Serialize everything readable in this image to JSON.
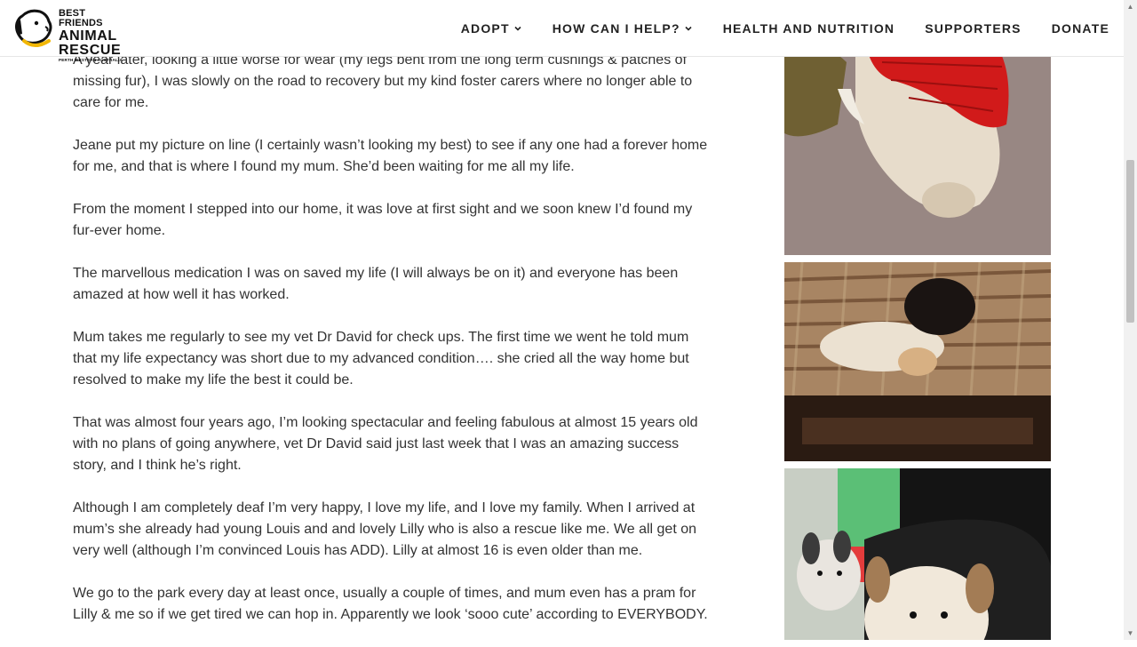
{
  "brand": {
    "line1": "BEST FRIENDS",
    "line2": "ANIMAL",
    "line3": "RESCUE",
    "line4": "PERTH WESTERN AUSTRALIA",
    "accent": "#f2b705"
  },
  "nav": {
    "items": [
      {
        "label": "ADOPT",
        "has_dropdown": true
      },
      {
        "label": "HOW CAN I HELP?",
        "has_dropdown": true
      },
      {
        "label": "HEALTH AND NUTRITION",
        "has_dropdown": false
      },
      {
        "label": "SUPPORTERS",
        "has_dropdown": false
      },
      {
        "label": "DONATE",
        "has_dropdown": false
      }
    ]
  },
  "story": {
    "paragraphs": [
      "A year later, looking a little worse for wear (my legs bent from the long term cushings & patches of missing fur), I was slowly on the road to recovery but my kind foster carers where no longer able to care for me.",
      "Jeane put my picture on line (I certainly wasn’t looking my best) to see if any one had a forever home for me, and that is where I found my mum. She’d been waiting for me all my life.",
      "From the moment I stepped into our home, it was love at first sight and we soon knew I’d found my fur-ever home.",
      "The marvellous medication I was on saved my life (I will always be on it) and everyone has been amazed at how well it has worked.",
      "Mum takes me regularly to see my vet Dr David for check ups. The first time we went he told mum that my life expectancy was short due to my advanced condition…. she cried all the way home but resolved to make my life the best it could be.",
      "That was almost four years ago, I’m looking spectacular and feeling fabulous at almost 15 years old with no plans of going anywhere, vet Dr David said just last week that I was an amazing success story, and I think he’s right.",
      "Although I am completely deaf I’m very happy, I love my life, and I love my family. When I arrived at mum’s she already had young Louis and and lovely Lilly who is also a rescue like me. We all get on very well (although I’m convinced Louis has ADD). Lilly at almost 16 is even older than me.",
      "We go to the park every day at least once, usually a couple of times, and mum even has a pram for Lilly & me so if we get tired we can hop in. Apparently we look ‘sooo cute’ according to EVERYBODY."
    ]
  },
  "gallery": {
    "photos": [
      {
        "icon": "dog-in-red-sweater-photo"
      },
      {
        "icon": "dogs-on-rug-photo"
      },
      {
        "icon": "dogs-in-pram-photo"
      }
    ]
  }
}
